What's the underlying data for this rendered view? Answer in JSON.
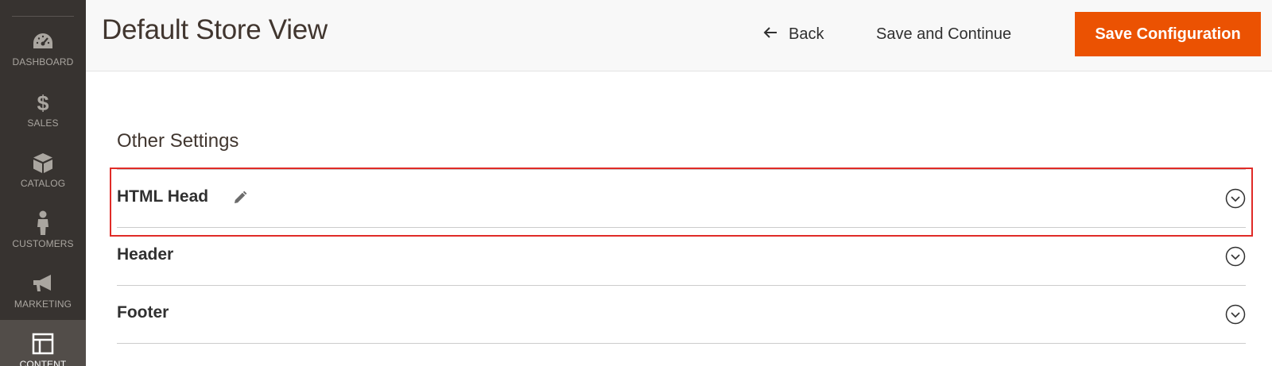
{
  "sidebar": {
    "items": [
      {
        "label": "DASHBOARD",
        "icon": "dashboard-icon"
      },
      {
        "label": "SALES",
        "icon": "dollar-icon"
      },
      {
        "label": "CATALOG",
        "icon": "box-icon"
      },
      {
        "label": "CUSTOMERS",
        "icon": "person-icon"
      },
      {
        "label": "MARKETING",
        "icon": "megaphone-icon"
      },
      {
        "label": "CONTENT",
        "icon": "layout-icon"
      }
    ]
  },
  "header": {
    "title": "Default Store View",
    "back_label": "Back",
    "save_continue_label": "Save and Continue",
    "save_config_label": "Save Configuration"
  },
  "content": {
    "section_title": "Other Settings",
    "groups": [
      {
        "label": "HTML Head",
        "editable": true
      },
      {
        "label": "Header"
      },
      {
        "label": "Footer"
      }
    ]
  },
  "colors": {
    "sidebar_bg": "#373330",
    "sidebar_active_bg": "#524d49",
    "primary_button": "#eb5202",
    "highlight_border": "#e02b27"
  }
}
